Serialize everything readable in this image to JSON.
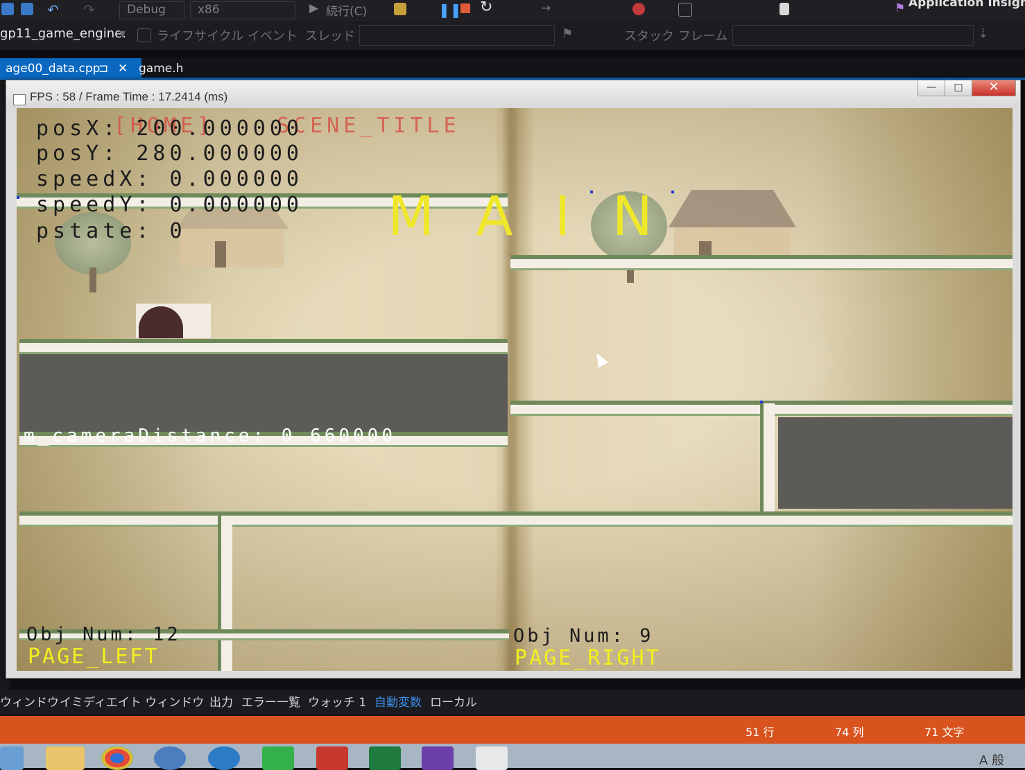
{
  "vs": {
    "toolbar": {
      "config": "Debug",
      "platform": "x86",
      "continue_label": "続行(C)",
      "app_insights": "Application Insights"
    },
    "toolbar2": {
      "project": "gp11_game_engine.",
      "lifecycle": "ライフサイクル イベント",
      "thread": "スレッド",
      "stackframe": "スタック フレーム"
    },
    "tabs": [
      {
        "label": "age00_data.cpp",
        "pin": "⊐",
        "close": "✕"
      },
      {
        "label": "game.h"
      }
    ]
  },
  "game_window": {
    "title": "FPS : 58 / Frame Time : 17.2414 (ms)",
    "buttons": {
      "minimize": "—",
      "maximize": "□",
      "close": "✕"
    },
    "debug": {
      "scene": "[HOME]",
      "scene_name": "SCENE_TITLE",
      "posX": "posX: 200.000000",
      "posY": "posY: 280.000000",
      "speedX": "speedX: 0.000000",
      "speedY": "speedY: 0.000000",
      "pstate": "pstate: 0",
      "main_label": "MAIN",
      "camera_distance": "m_cameraDistance: 0.660000",
      "obj_left": "Obj Num: 12",
      "obj_right": "Obj Num: 9",
      "page_left": "PAGE_LEFT",
      "page_right": "PAGE_RIGHT"
    }
  },
  "bottom_tabs": [
    "ウィンドウ",
    "イミディエイト ウィンドウ",
    "出力",
    "エラー一覧",
    "ウォッチ 1",
    "自動変数",
    "ローカル"
  ],
  "status": {
    "line": "51 行",
    "col": "74 列",
    "chars": "71 文字"
  },
  "taskbar": {
    "ime": "A 般"
  },
  "colors": {
    "vs_accent": "#0a68c0",
    "status_bar": "#d9531e",
    "debug_yellow": "#f2ef1e"
  }
}
